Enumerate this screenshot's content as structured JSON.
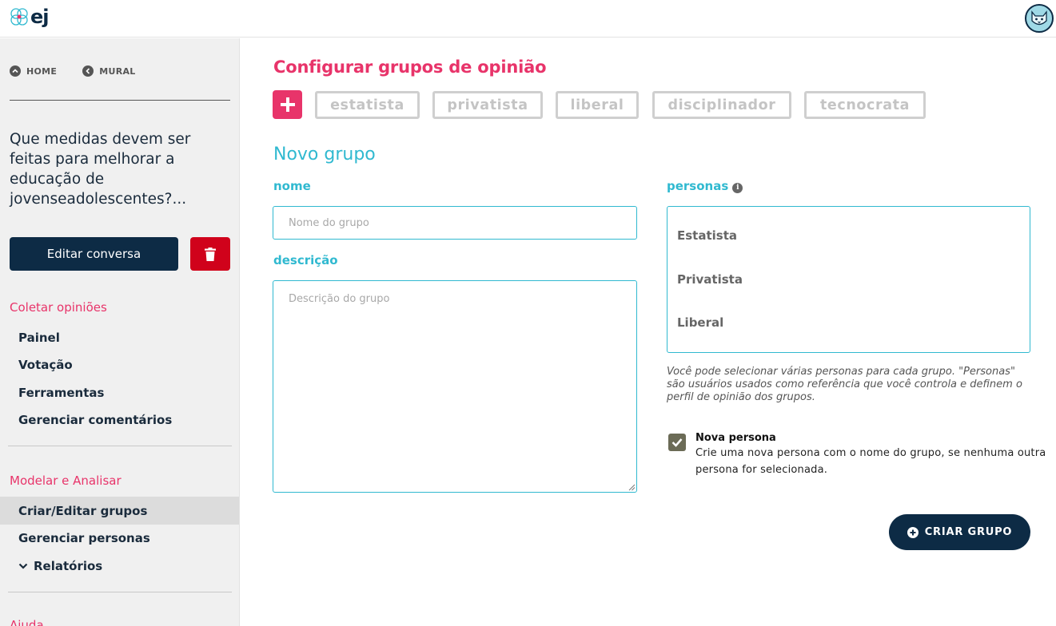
{
  "header": {
    "logo_text": "ej",
    "avatar_icon": "cat-avatar-icon"
  },
  "sidebar": {
    "home_label": "HOME",
    "mural_label": "MURAL",
    "question": "Que medidas devem ser feitas para melhorar a educação de jovenseadolescentes?...",
    "edit_button": "Editar conversa",
    "section_collect": "Coletar opiniões",
    "collect_items": [
      "Painel",
      "Votação",
      "Ferramentas",
      "Gerenciar comentários"
    ],
    "section_model": "Modelar e Analisar",
    "model_items": [
      "Criar/Editar grupos",
      "Gerenciar personas",
      "Relatórios"
    ],
    "section_help": "Ajuda"
  },
  "main": {
    "title": "Configurar grupos de opinião",
    "tags": [
      "estatista",
      "privatista",
      "liberal",
      "disciplinador",
      "tecnocrata"
    ],
    "subtitle": "Novo grupo",
    "name_label": "nome",
    "name_placeholder": "Nome do grupo",
    "desc_label": "descrição",
    "desc_placeholder": "Descrição do grupo",
    "personas_label": "personas",
    "personas_options": [
      "Estatista",
      "Privatista",
      "Liberal"
    ],
    "help_text": "Você pode selecionar várias personas para cada grupo. \"Personas\" são usuários usados como referência que você controla e definem o perfil de opinião dos grupos.",
    "new_persona_title": "Nova persona",
    "new_persona_desc": "Crie uma nova persona com o nome do grupo, se nenhuma outra persona for selecionada.",
    "new_persona_checked": true,
    "create_button": "CRIAR GRUPO"
  },
  "colors": {
    "accent_pink": "#e8346a",
    "accent_cyan": "#30b9d0",
    "navy": "#0d2b45",
    "danger": "#d0021b"
  }
}
